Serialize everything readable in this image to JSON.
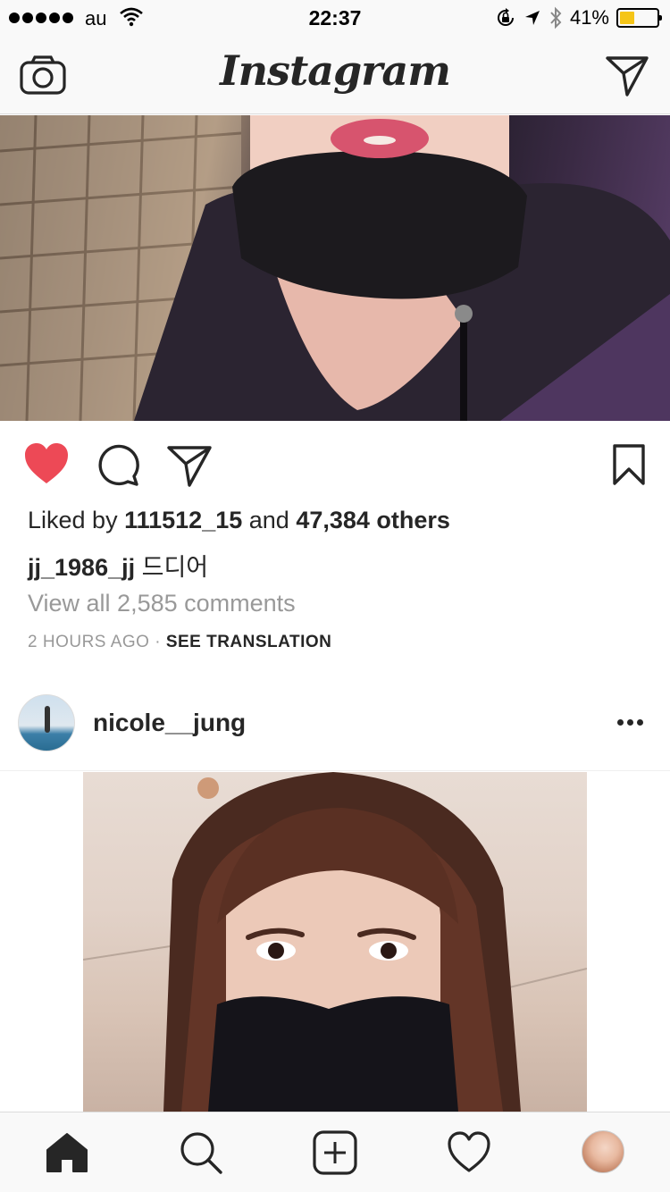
{
  "status_bar": {
    "carrier": "au",
    "time": "22:37",
    "battery_pct": "41%",
    "battery_level": 0.41,
    "icons": [
      "signal-dots",
      "wifi-icon",
      "orientation-lock-icon",
      "location-arrow-icon",
      "bluetooth-icon",
      "battery-icon"
    ]
  },
  "header": {
    "logo": "Instagram",
    "left_icon": "camera-icon",
    "right_icon": "direct-message-icon"
  },
  "post1": {
    "liked": true,
    "likes_prefix": "Liked by ",
    "liked_by_user": "111512_15",
    "likes_middle": " and ",
    "likes_count": "47,384 others",
    "author": "jj_1986_jj",
    "caption": "드디어",
    "view_comments": "View all 2,585 comments",
    "time_ago": "2 HOURS AGO",
    "separator": " · ",
    "translate_label": "SEE TRANSLATION"
  },
  "post2": {
    "username": "nicole__jung",
    "more_icon": "more-options-icon"
  },
  "tab_bar": {
    "items": [
      "home-icon",
      "search-icon",
      "add-post-icon",
      "activity-heart-icon",
      "profile-avatar"
    ]
  },
  "colors": {
    "like_red": "#ed4956",
    "text": "#262626",
    "muted": "#999999",
    "battery_yellow": "#f5c518"
  }
}
